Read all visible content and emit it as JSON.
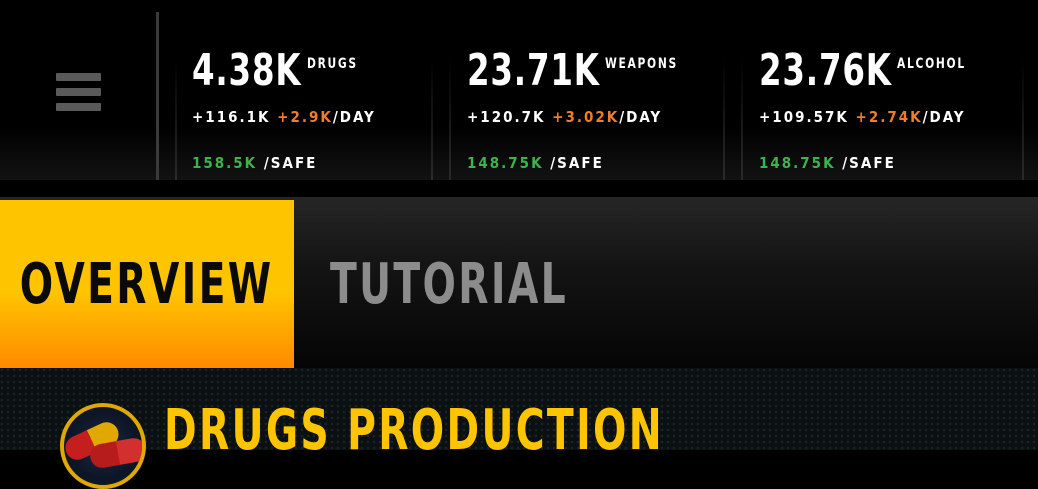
{
  "menu": {
    "icon": "hamburger-menu-icon"
  },
  "resources": [
    {
      "name": "DRUGS",
      "amount": "4.38K",
      "base_rate": "+116.1K",
      "bonus_rate": "+2.9K",
      "per_day": "/DAY",
      "safe_amount": "158.5K",
      "safe_label": "/SAFE"
    },
    {
      "name": "WEAPONS",
      "amount": "23.71K",
      "base_rate": "+120.7K",
      "bonus_rate": "+3.02K",
      "per_day": "/DAY",
      "safe_amount": "148.75K",
      "safe_label": "/SAFE"
    },
    {
      "name": "ALCOHOL",
      "amount": "23.76K",
      "base_rate": "+109.57K",
      "bonus_rate": "+2.74K",
      "per_day": "/DAY",
      "safe_amount": "148.75K",
      "safe_label": "/SAFE"
    }
  ],
  "tabs": [
    {
      "label": "OVERVIEW",
      "active": true
    },
    {
      "label": "TUTORIAL",
      "active": false
    }
  ],
  "section": {
    "title": "DRUGS PRODUCTION",
    "icon": "pills-icon"
  },
  "colors": {
    "accent": "#ffc400",
    "accent_gradient_end": "#ff8a00",
    "bonus": "#f07d2a",
    "safe": "#3fb24b",
    "inactive_tab": "#8c8c8c"
  }
}
